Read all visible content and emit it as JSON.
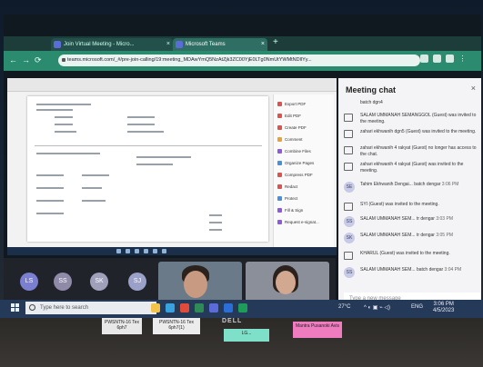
{
  "browser": {
    "tabs": [
      {
        "label": "Join Virtual Meeting - Micro..."
      },
      {
        "label": "Microsoft Teams"
      }
    ],
    "url": "teams.microsoft.com/_#/pre-join-calling/19:meeting_MDAwYmQ5NzAtZjk3ZC00YjE0LTg0NmUtYWMtNDllYy..."
  },
  "shared_screen": {
    "panel_items": [
      "Export PDF",
      "Edit PDF",
      "Create PDF",
      "Comment",
      "Combine Files",
      "Organize Pages",
      "Compress PDF",
      "Redact",
      "Protect",
      "Fill & Sign",
      "Request e-signat..."
    ]
  },
  "participants": {
    "initials": [
      "LS",
      "SS",
      "SK",
      "SJ"
    ]
  },
  "chat": {
    "title": "Meeting chat",
    "close": "×",
    "messages": [
      {
        "text": "batch dgn4",
        "time": ""
      },
      {
        "text": "SALAM UMMANAH SEMANGGOL (Guest) was invited to the meeting.",
        "time": ""
      },
      {
        "text": "zahari ekhwanih dgn5 (Guest) was invited to the meeting.",
        "time": ""
      },
      {
        "text": "zahari ekhwanih 4 rakyat (Guest) no longer has access to the chat.",
        "time": ""
      },
      {
        "text": "zahari ekhwanih 4 rakyat (Guest) was invited to the meeting.",
        "time": ""
      },
      {
        "avatar": "SE",
        "text": "Tahim Ekhwanih Dengai... batch dengar",
        "time": "3:06 PM"
      },
      {
        "text": "SYI (Guest) was invited to the meeting.",
        "time": ""
      },
      {
        "avatar": "SS",
        "text": "SALAM UMMANAH SEM... tr dengar",
        "time": "3:03 PM"
      },
      {
        "avatar": "SK",
        "text": "SALAM UMMANAH SEM... tr dengar",
        "time": "3:05 PM"
      },
      {
        "text": "KHARUL (Guest) was invited to the meeting.",
        "time": ""
      },
      {
        "avatar": "SS",
        "text": "SALAM UMMANAH SEM... batch dengar",
        "time": "3:04 PM"
      }
    ],
    "compose_placeholder": "Type a new message"
  },
  "taskbar": {
    "search_placeholder": "Type here to search",
    "weather": "27°C",
    "language": "ENG",
    "time": "3:06 PM",
    "date": "4/5/2023"
  },
  "desk_notes": [
    {
      "text": "PWSNTN-16 Tex 6ph7"
    },
    {
      "text": "PWSNTN-16 Tex 6ph7(1)"
    },
    {
      "text": "LG..."
    },
    {
      "text": "Mantra Pusanoki Avis"
    }
  ],
  "brand": "DELL",
  "colors": {
    "teams_accent": "#5b6bd8",
    "chrome_bar": "#2a8b6e",
    "taskbar": "#243a58"
  }
}
